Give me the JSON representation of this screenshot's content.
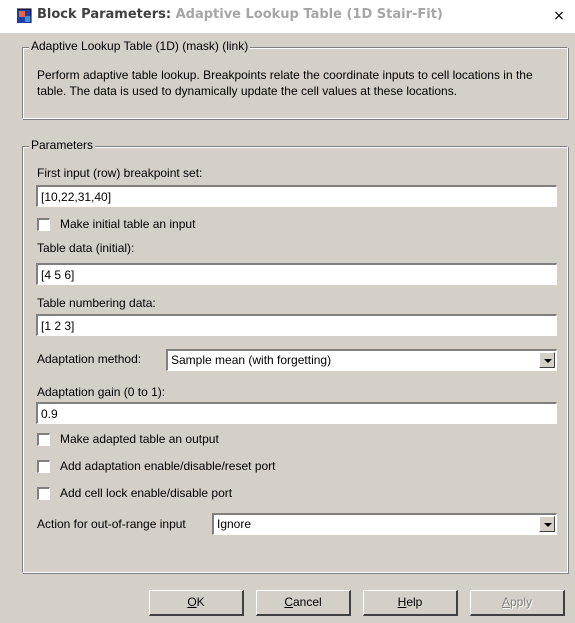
{
  "window": {
    "title_prefix": "Block Parameters: ",
    "title_main": "Adaptive Lookup Table (1D Stair-Fit)",
    "close_glyph": "×"
  },
  "mask_group": {
    "label": "Adaptive Lookup Table (1D) (mask) (link)",
    "description": "Perform adaptive table lookup.  Breakpoints relate the coordinate inputs to cell locations in the table.  The data is used to dynamically update the cell values at these locations."
  },
  "params": {
    "label": "Parameters",
    "breakpoint_label": "First input (row) breakpoint set:",
    "breakpoint_value": "[10,22,31,40]",
    "make_initial_table_input_label": "Make initial table an input",
    "make_initial_table_input_checked": false,
    "table_data_label": "Table data (initial):",
    "table_data_value": "[4 5 6]",
    "numbering_label": "Table numbering data:",
    "numbering_value": "[1 2 3]",
    "adaptation_method_label": "Adaptation method:",
    "adaptation_method_value": "Sample mean (with forgetting)",
    "adaptation_gain_label": "Adaptation gain (0 to 1):",
    "adaptation_gain_value": "0.9",
    "adapted_table_output_label": "Make adapted table an output",
    "adapted_table_output_checked": false,
    "adaptation_port_label": "Add adaptation enable/disable/reset port",
    "adaptation_port_checked": false,
    "cell_lock_port_label": "Add cell lock enable/disable port",
    "cell_lock_port_checked": false,
    "out_of_range_label": "Action for out-of-range input",
    "out_of_range_value": "Ignore"
  },
  "buttons": {
    "ok_mnemonic": "O",
    "ok_rest": "K",
    "cancel_mnemonic": "C",
    "cancel_rest": "ancel",
    "help_mnemonic": "H",
    "help_rest": "elp",
    "apply_mnemonic": "A",
    "apply_rest": "pply"
  },
  "icons": {
    "title_icon": "simulink-block-icon",
    "dropdown": "chevron-down-icon"
  }
}
